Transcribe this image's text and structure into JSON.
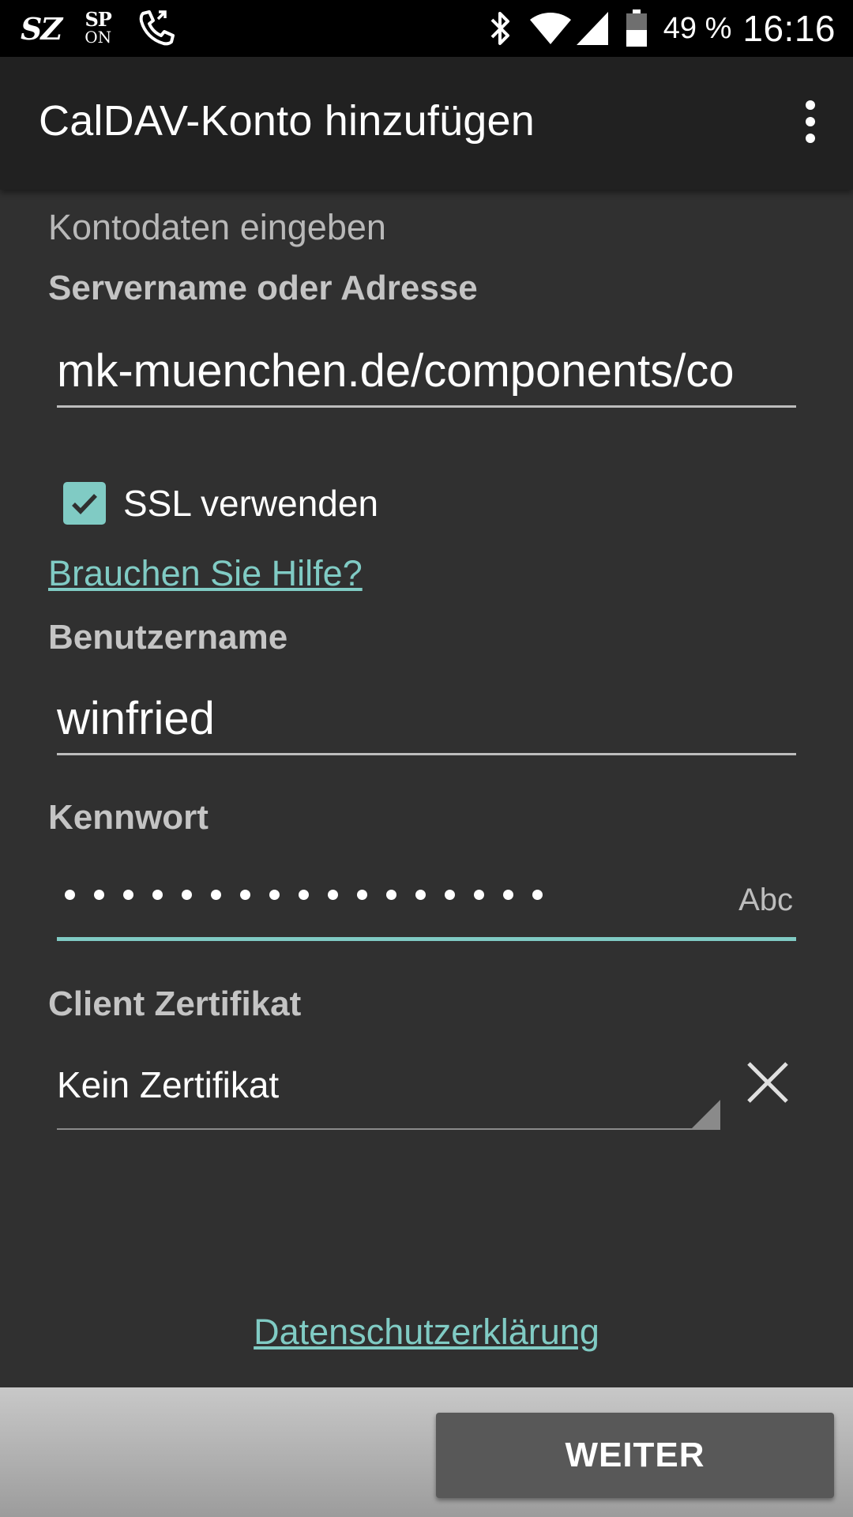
{
  "status_bar": {
    "app_icon_1": "SZ",
    "app_icon_2_top": "SP",
    "app_icon_2_bottom": "ON",
    "battery_percent": "49 %",
    "time": "16:16",
    "icons": [
      "phone-call-icon",
      "bluetooth-icon",
      "wifi-icon",
      "cell-signal-icon",
      "battery-icon"
    ]
  },
  "app_bar": {
    "title": "CalDAV-Konto hinzufügen",
    "menu_icon": "overflow-menu-icon"
  },
  "form": {
    "section_title": "Kontodaten eingeben",
    "server": {
      "label": "Servername oder Adresse",
      "value": "mk-muenchen.de/components/co"
    },
    "ssl": {
      "label": "SSL verwenden",
      "checked": true
    },
    "help_link": "Brauchen Sie Hilfe?",
    "username": {
      "label": "Benutzername",
      "value": "winfried"
    },
    "password": {
      "label": "Kennwort",
      "masked_length": 17,
      "hint": "Abc"
    },
    "certificate": {
      "label": "Client Zertifikat",
      "value": "Kein Zertifikat",
      "clear_icon": "close-icon"
    },
    "privacy_link": "Datenschutzerklärung"
  },
  "footer": {
    "next_label": "WEITER"
  },
  "colors": {
    "accent": "#80cbc4",
    "background": "#303030",
    "app_bar": "#212121",
    "status_bar": "#000000",
    "button": "#585858"
  }
}
